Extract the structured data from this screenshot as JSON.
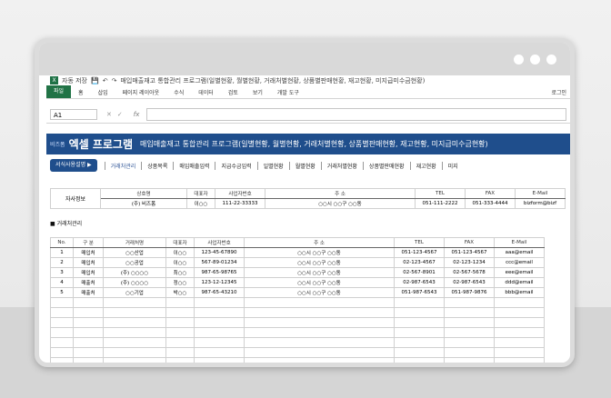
{
  "titlebar": {
    "save_label": "자동 저장",
    "file_title": "매입매출재고 통합관리 프로그램(일별현황, 월별현황, 거래처별현황, 상품별판매현황, 재고현황, 미지급미수금현황)",
    "user": "로그인"
  },
  "ribbon": {
    "tabs": [
      "파일",
      "홈",
      "삽입",
      "페이지 레이아웃",
      "수식",
      "데이터",
      "검토",
      "보기",
      "개발 도구"
    ]
  },
  "formula_bar": {
    "name_box": "A1",
    "fx": "fx"
  },
  "banner": {
    "brand": "비즈폼",
    "program_name": "엑셀 프로그램",
    "subtitle": "매입매출재고 통합관리 프로그램(일별현황, 월별현황, 거래처별현황, 상품별판매현황, 재고현황, 미지급미수금현황)"
  },
  "menu": {
    "guide_button": "서식사용설명",
    "items": [
      "거래처관리",
      "상품목록",
      "매입매출입력",
      "지급수금입력",
      "일별현황",
      "월별현황",
      "거래처별현황",
      "상품별판매현황",
      "재고현황",
      "미지"
    ]
  },
  "company": {
    "label": "자사정보",
    "headers": [
      "상호명",
      "대표자",
      "사업자번호",
      "주 소",
      "TEL",
      "FAX",
      "E-Mail"
    ],
    "row": [
      "(주) 비즈폼",
      "이○○",
      "111-22-33333",
      "○○시 ○○구 ○○동",
      "051-111-2222",
      "051-333-4444",
      "bizform@bizf"
    ]
  },
  "clients": {
    "section_title": "■ 거래처관리",
    "headers": [
      "No.",
      "구 분",
      "거래처명",
      "대표자",
      "사업자번호",
      "주 소",
      "TEL",
      "FAX",
      "E-Mail"
    ],
    "rows": [
      [
        "1",
        "매입처",
        "○○산업",
        "이○○",
        "123-45-67890",
        "○○시 ○○구 ○○동",
        "051-123-4567",
        "051-123-4567",
        "aaa@email"
      ],
      [
        "2",
        "매입처",
        "○○공업",
        "이○○",
        "567-89-01234",
        "○○시 ○○구 ○○동",
        "02-123-4567",
        "02-123-1234",
        "ccc@email"
      ],
      [
        "3",
        "매입처",
        "(주) ○○○○",
        "최○○",
        "987-65-98765",
        "○○시 ○○구 ○○동",
        "02-567-8901",
        "02-567-5678",
        "eee@email"
      ],
      [
        "4",
        "매출처",
        "(주) ○○○○",
        "정○○",
        "123-12-12345",
        "○○시 ○○구 ○○동",
        "02-987-6543",
        "02-987-6543",
        "ddd@email"
      ],
      [
        "5",
        "매출처",
        "○○기업",
        "박○○",
        "987-65-43210",
        "○○시 ○○구 ○○동",
        "051-987-6543",
        "051-987-9876",
        "bbb@email"
      ]
    ]
  }
}
